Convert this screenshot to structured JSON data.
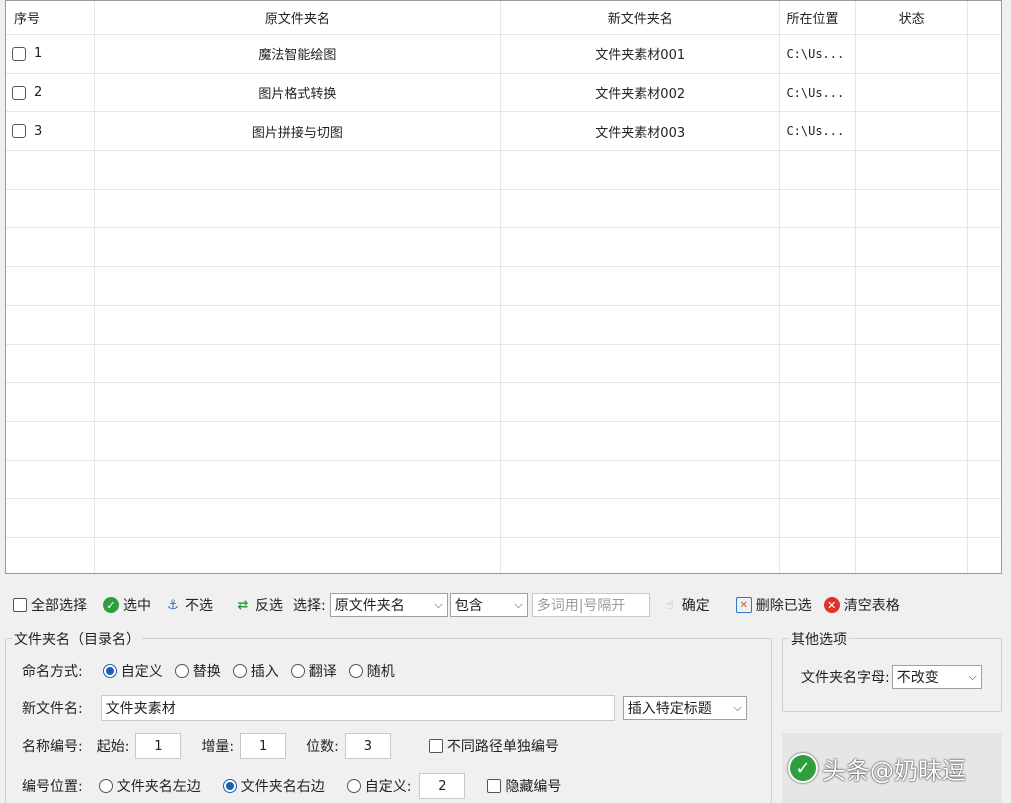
{
  "table": {
    "headers": [
      "序号",
      "原文件夹名",
      "新文件夹名",
      "所在位置",
      "状态",
      ""
    ],
    "rows": [
      {
        "index": "1",
        "original": "魔法智能绘图",
        "new": "文件夹素材001",
        "location": "C:\\Us...",
        "status": ""
      },
      {
        "index": "2",
        "original": "图片格式转换",
        "new": "文件夹素材002",
        "location": "C:\\Us...",
        "status": ""
      },
      {
        "index": "3",
        "original": "图片拼接与切图",
        "new": "文件夹素材003",
        "location": "C:\\Us...",
        "status": ""
      }
    ],
    "empty_rows": 11
  },
  "toolbar": {
    "select_all": "全部选择",
    "select": "选中",
    "deselect": "不选",
    "invert": "反选",
    "choose_label": "选择:",
    "field_select": "原文件夹名",
    "match_select": "包含",
    "keywords_placeholder": "多词用|号隔开",
    "confirm": "确定",
    "delete_selected": "删除已选",
    "clear_table": "清空表格"
  },
  "folder_group": {
    "legend": "文件夹名（目录名）",
    "naming_label": "命名方式:",
    "naming_options": [
      "自定义",
      "替换",
      "插入",
      "翻译",
      "随机"
    ],
    "naming_selected": 0,
    "new_name_label": "新文件名:",
    "new_name_value": "文件夹素材",
    "insert_title_select": "插入特定标题",
    "numbering_label": "名称编号:",
    "start_label": "起始:",
    "start_value": "1",
    "increment_label": "增量:",
    "increment_value": "1",
    "digits_label": "位数:",
    "digits_value": "3",
    "separate_path_label": "不同路径单独编号",
    "position_label": "编号位置:",
    "position_options": [
      "文件夹名左边",
      "文件夹名右边",
      "自定义:"
    ],
    "position_selected": 1,
    "custom_value": "2",
    "hide_number_label": "隐藏编号"
  },
  "other_group": {
    "legend": "其他选项",
    "case_label": "文件夹名字母:",
    "case_select": "不改变"
  },
  "watermark": {
    "text": "头条@奶昧逗"
  }
}
